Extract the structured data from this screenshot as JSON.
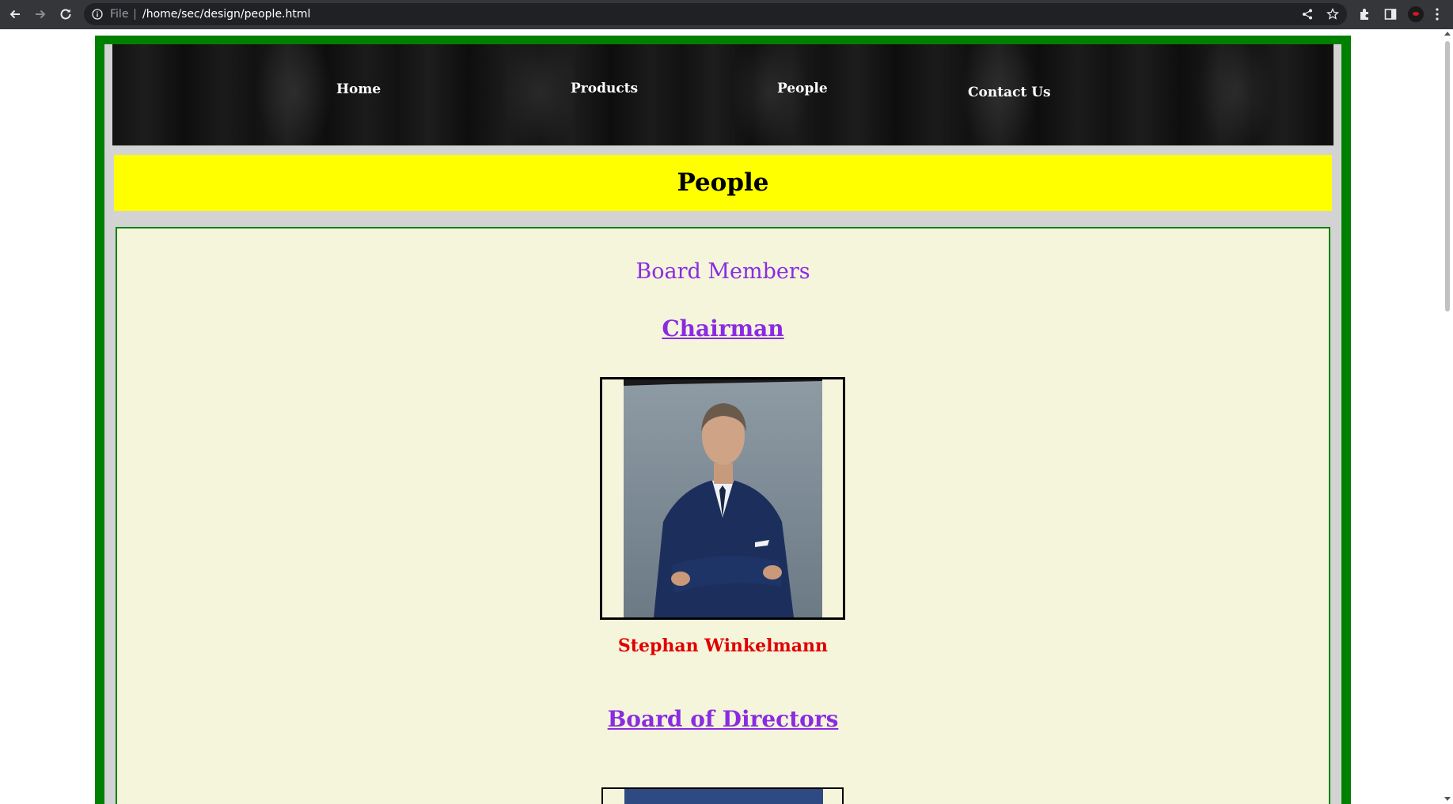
{
  "browser": {
    "scheme_label": "File",
    "url": "/home/sec/design/people.html"
  },
  "nav": {
    "items": [
      {
        "label": "Home"
      },
      {
        "label": "Products"
      },
      {
        "label": "People"
      },
      {
        "label": "Contact Us"
      }
    ]
  },
  "page": {
    "banner_title": "People",
    "section_title": "Board Members",
    "chairman_heading": "Chairman",
    "chairman_name": "Stephan Winkelmann",
    "board_heading": "Board of Directors"
  },
  "colors": {
    "frame": "#008000",
    "banner": "#ffff00",
    "content_bg": "#f5f5dc",
    "heading_purple": "#8a2be2",
    "name_red": "#e00000"
  }
}
